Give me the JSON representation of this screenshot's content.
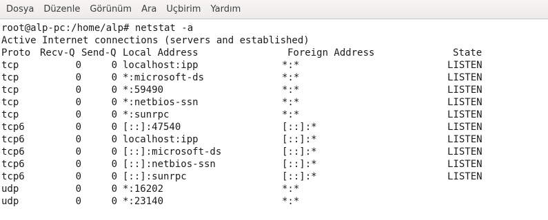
{
  "menubar": {
    "items": [
      "Dosya",
      "Düzenle",
      "Görünüm",
      "Ara",
      "Uçbirim",
      "Yardım"
    ]
  },
  "terminal": {
    "prompt_line": "root@alp-pc:/home/alp# netstat -a",
    "title_line": "Active Internet connections (servers and established)",
    "headers": {
      "proto": "Proto",
      "recv": "Recv-Q",
      "send": "Send-Q",
      "local": "Local Address",
      "foreign": "Foreign Address",
      "state": "State"
    },
    "rows": [
      {
        "proto": "tcp",
        "recv": "0",
        "send": "0",
        "local": "localhost:ipp",
        "foreign": "*:*",
        "state": "LISTEN"
      },
      {
        "proto": "tcp",
        "recv": "0",
        "send": "0",
        "local": "*:microsoft-ds",
        "foreign": "*:*",
        "state": "LISTEN"
      },
      {
        "proto": "tcp",
        "recv": "0",
        "send": "0",
        "local": "*:59490",
        "foreign": "*:*",
        "state": "LISTEN"
      },
      {
        "proto": "tcp",
        "recv": "0",
        "send": "0",
        "local": "*:netbios-ssn",
        "foreign": "*:*",
        "state": "LISTEN"
      },
      {
        "proto": "tcp",
        "recv": "0",
        "send": "0",
        "local": "*:sunrpc",
        "foreign": "*:*",
        "state": "LISTEN"
      },
      {
        "proto": "tcp6",
        "recv": "0",
        "send": "0",
        "local": "[::]:47540",
        "foreign": "[::]:*",
        "state": "LISTEN"
      },
      {
        "proto": "tcp6",
        "recv": "0",
        "send": "0",
        "local": "localhost:ipp",
        "foreign": "[::]:*",
        "state": "LISTEN"
      },
      {
        "proto": "tcp6",
        "recv": "0",
        "send": "0",
        "local": "[::]:microsoft-ds",
        "foreign": "[::]:*",
        "state": "LISTEN"
      },
      {
        "proto": "tcp6",
        "recv": "0",
        "send": "0",
        "local": "[::]:netbios-ssn",
        "foreign": "[::]:*",
        "state": "LISTEN"
      },
      {
        "proto": "tcp6",
        "recv": "0",
        "send": "0",
        "local": "[::]:sunrpc",
        "foreign": "[::]:*",
        "state": "LISTEN"
      },
      {
        "proto": "udp",
        "recv": "0",
        "send": "0",
        "local": "*:16202",
        "foreign": "*:*",
        "state": ""
      },
      {
        "proto": "udp",
        "recv": "0",
        "send": "0",
        "local": "*:23140",
        "foreign": "*:*",
        "state": ""
      }
    ]
  }
}
